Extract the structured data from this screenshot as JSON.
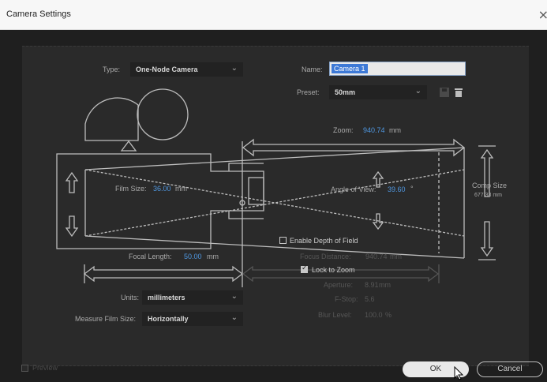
{
  "window": {
    "title": "Camera Settings",
    "close_glyph": "×"
  },
  "type": {
    "label": "Type:",
    "value": "One-Node Camera"
  },
  "name": {
    "label": "Name:",
    "value": "Camera 1"
  },
  "preset": {
    "label": "Preset:",
    "value": "50mm"
  },
  "zoom": {
    "label": "Zoom:",
    "value": "940.74",
    "unit": "mm"
  },
  "film_size": {
    "label": "Film Size:",
    "value": "36.00",
    "unit": "mm"
  },
  "angle_of_view": {
    "label": "Angle of View:",
    "value": "39.60",
    "unit": "°"
  },
  "comp_size": {
    "label": "Comp Size",
    "value": "677.33 mm"
  },
  "focal_length": {
    "label": "Focal Length:",
    "value": "50.00",
    "unit": "mm"
  },
  "depth_of_field": {
    "label": "Enable Depth of Field",
    "checked": false
  },
  "focus_distance": {
    "label": "Focus Distance:",
    "value": "940.74",
    "unit": "mm"
  },
  "lock_to_zoom": {
    "label": "Lock to Zoom",
    "checked": true
  },
  "aperture": {
    "label": "Aperture:",
    "value": "8.91",
    "unit": "mm"
  },
  "fstop": {
    "label": "F-Stop:",
    "value": "5.6"
  },
  "blur_level": {
    "label": "Blur Level:",
    "value": "100.0",
    "unit": "%"
  },
  "units": {
    "label": "Units:",
    "value": "millimeters"
  },
  "measure_film_size": {
    "label": "Measure Film Size:",
    "value": "Horizontally"
  },
  "preview": {
    "label": "Preview",
    "checked": false
  },
  "buttons": {
    "ok": "OK",
    "cancel": "Cancel"
  },
  "icons": {
    "dropdown": "chevron-down-icon",
    "save_preset": "save-preset-icon",
    "delete_preset": "trash-icon"
  },
  "colors": {
    "accent": "#4f97e0",
    "panel": "#2a2a2a",
    "diagram": "#bdbdbd",
    "selection": "#3d79d6"
  }
}
